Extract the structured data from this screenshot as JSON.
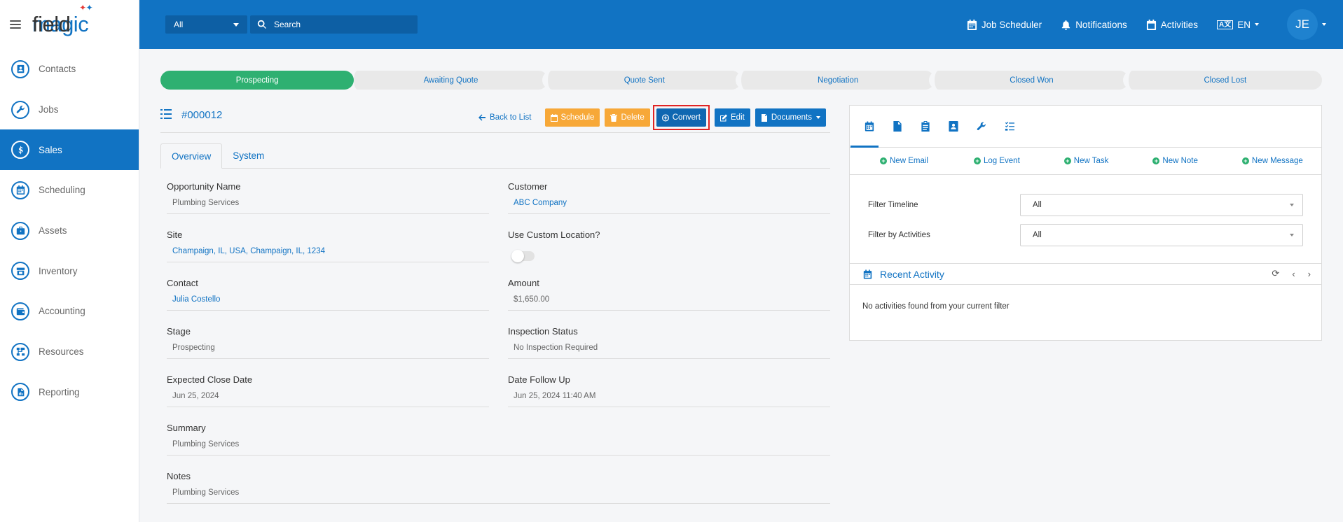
{
  "logo": {
    "field": "field",
    "magic": "magic"
  },
  "sidebar": {
    "items": [
      {
        "label": "Contacts",
        "icon": "contacts-icon"
      },
      {
        "label": "Jobs",
        "icon": "wrench-icon"
      },
      {
        "label": "Sales",
        "icon": "dollar-icon",
        "active": true
      },
      {
        "label": "Scheduling",
        "icon": "calendar-icon"
      },
      {
        "label": "Assets",
        "icon": "briefcase-icon"
      },
      {
        "label": "Inventory",
        "icon": "store-icon"
      },
      {
        "label": "Accounting",
        "icon": "wallet-icon"
      },
      {
        "label": "Resources",
        "icon": "sitemap-icon"
      },
      {
        "label": "Reporting",
        "icon": "report-icon"
      }
    ]
  },
  "header": {
    "filter_value": "All",
    "search_placeholder": "Search",
    "job_scheduler": "Job Scheduler",
    "notifications": "Notifications",
    "activities": "Activities",
    "lang_flag": "A文",
    "lang": "EN",
    "avatar_initials": "JE",
    "brand_color": "#1173c3"
  },
  "stages": [
    {
      "label": "Prospecting",
      "active": true
    },
    {
      "label": "Awaiting Quote"
    },
    {
      "label": "Quote Sent"
    },
    {
      "label": "Negotiation"
    },
    {
      "label": "Closed Won"
    },
    {
      "label": "Closed Lost"
    }
  ],
  "record": {
    "id": "#000012",
    "back_label": "Back to List",
    "schedule_label": "Schedule",
    "delete_label": "Delete",
    "convert_label": "Convert",
    "edit_label": "Edit",
    "documents_label": "Documents"
  },
  "tabs": {
    "overview": "Overview",
    "system": "System"
  },
  "fields": {
    "opportunity_name": {
      "label": "Opportunity Name",
      "value": "Plumbing Services"
    },
    "customer": {
      "label": "Customer",
      "value": "ABC Company"
    },
    "site": {
      "label": "Site",
      "value": "Champaign, IL, USA, Champaign, IL, 1234"
    },
    "use_custom_location": {
      "label": "Use Custom Location?",
      "value": false
    },
    "contact": {
      "label": "Contact",
      "value": "Julia Costello"
    },
    "amount": {
      "label": "Amount",
      "value": "$1,650.00"
    },
    "stage": {
      "label": "Stage",
      "value": "Prospecting"
    },
    "inspection_status": {
      "label": "Inspection Status",
      "value": "No Inspection Required"
    },
    "expected_close_date": {
      "label": "Expected Close Date",
      "value": "Jun 25, 2024"
    },
    "date_follow_up": {
      "label": "Date Follow Up",
      "value": "Jun 25, 2024 11:40 AM"
    },
    "summary": {
      "label": "Summary",
      "value": "Plumbing Services"
    },
    "notes": {
      "label": "Notes",
      "value": "Plumbing Services"
    }
  },
  "activity_panel": {
    "quick_actions": [
      "New Email",
      "Log Event",
      "New Task",
      "New Note",
      "New Message"
    ],
    "filter_timeline_label": "Filter Timeline",
    "filter_timeline_value": "All",
    "filter_activities_label": "Filter by Activities",
    "filter_activities_value": "All",
    "recent_title": "Recent Activity",
    "empty_message": "No activities found from your current filter"
  }
}
